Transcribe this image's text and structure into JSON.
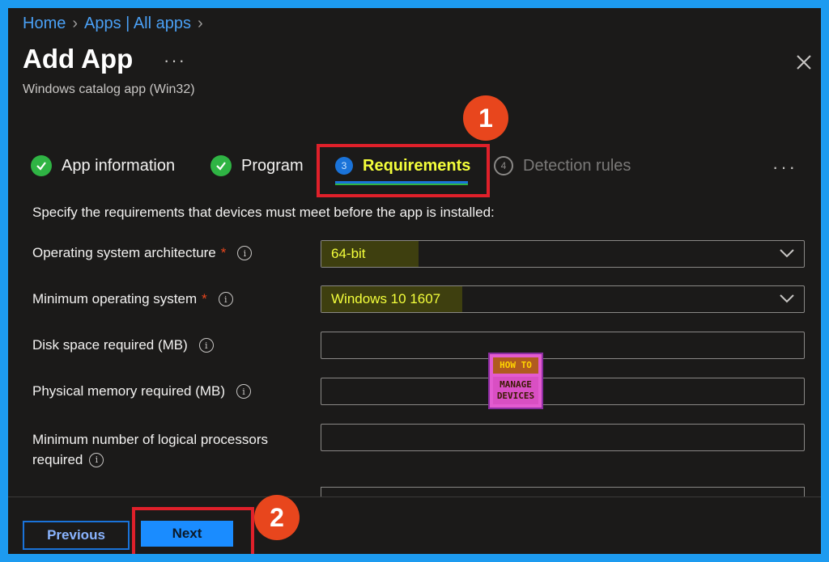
{
  "breadcrumb": {
    "items": [
      "Home",
      "Apps | All apps"
    ]
  },
  "header": {
    "title": "Add App",
    "more": "···",
    "subtitle": "Windows catalog app (Win32)"
  },
  "callouts": {
    "one": "1",
    "two": "2"
  },
  "tabs": [
    {
      "label": "App information",
      "state": "complete"
    },
    {
      "label": "Program",
      "state": "complete"
    },
    {
      "label": "Requirements",
      "state": "current",
      "number": "3"
    },
    {
      "label": "Detection rules",
      "state": "disabled",
      "number": "4"
    }
  ],
  "tabs_more": "···",
  "instructions": "Specify the requirements that devices must meet before the app is installed:",
  "fields": {
    "os_arch": {
      "label": "Operating system architecture",
      "required": "*",
      "value": "64-bit"
    },
    "min_os": {
      "label": "Minimum operating system",
      "required": "*",
      "value": "Windows 10 1607"
    },
    "disk": {
      "label": "Disk space required (MB)",
      "value": ""
    },
    "memory": {
      "label": "Physical memory required (MB)",
      "value": ""
    },
    "processors": {
      "label_line1": "Minimum number of logical processors",
      "label_line2": "required",
      "value": ""
    }
  },
  "info_glyph": "i",
  "footer": {
    "previous": "Previous",
    "next": "Next"
  },
  "logo": {
    "line1": "HOW TO",
    "line2": "MANAGE",
    "line3": "DEVICES"
  },
  "colors": {
    "accent": "#1a73d9",
    "highlight_text": "#f4ff3b",
    "callout": "#e8461d",
    "check": "#2fb444",
    "border_highlight": "#e0202a"
  }
}
